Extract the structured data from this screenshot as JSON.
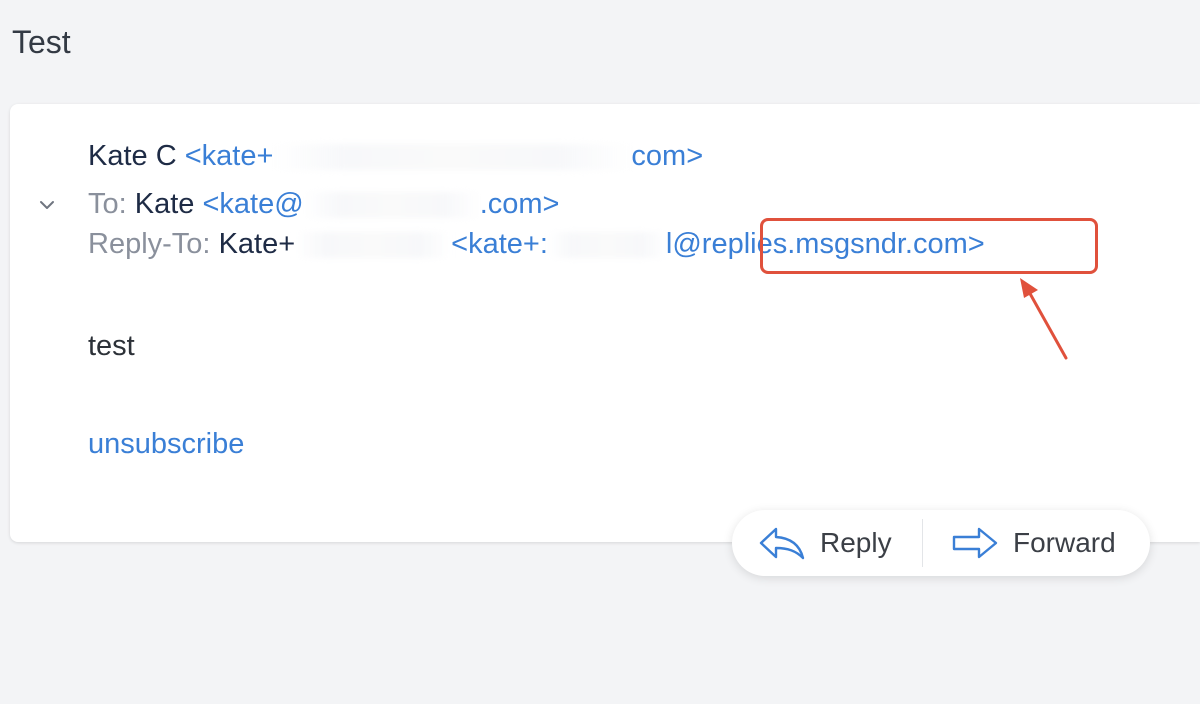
{
  "subject": "Test",
  "message": {
    "from_name": "Kate C",
    "from_email_start": "<kate+",
    "from_email_end": "com>",
    "to_label": "To:",
    "to_name": "Kate",
    "to_email_start": "<kate@",
    "to_email_end": ".com>",
    "replyto_label": "Reply-To:",
    "replyto_name_start": "Kate+",
    "replyto_email_start": "<kate+:",
    "replyto_email_mid": "l@",
    "replyto_domain": "replies.msgsndr.com",
    "replyto_email_end": ">",
    "body": "test",
    "unsubscribe": "unsubscribe"
  },
  "actions": {
    "reply": "Reply",
    "forward": "Forward"
  },
  "colors": {
    "link": "#3a7fd6",
    "highlight": "#e0513c"
  },
  "icons": {
    "chevron": "chevron-down-icon",
    "reply": "reply-arrow-icon",
    "forward": "forward-arrow-icon",
    "annotation": "annotation-arrow-icon"
  }
}
